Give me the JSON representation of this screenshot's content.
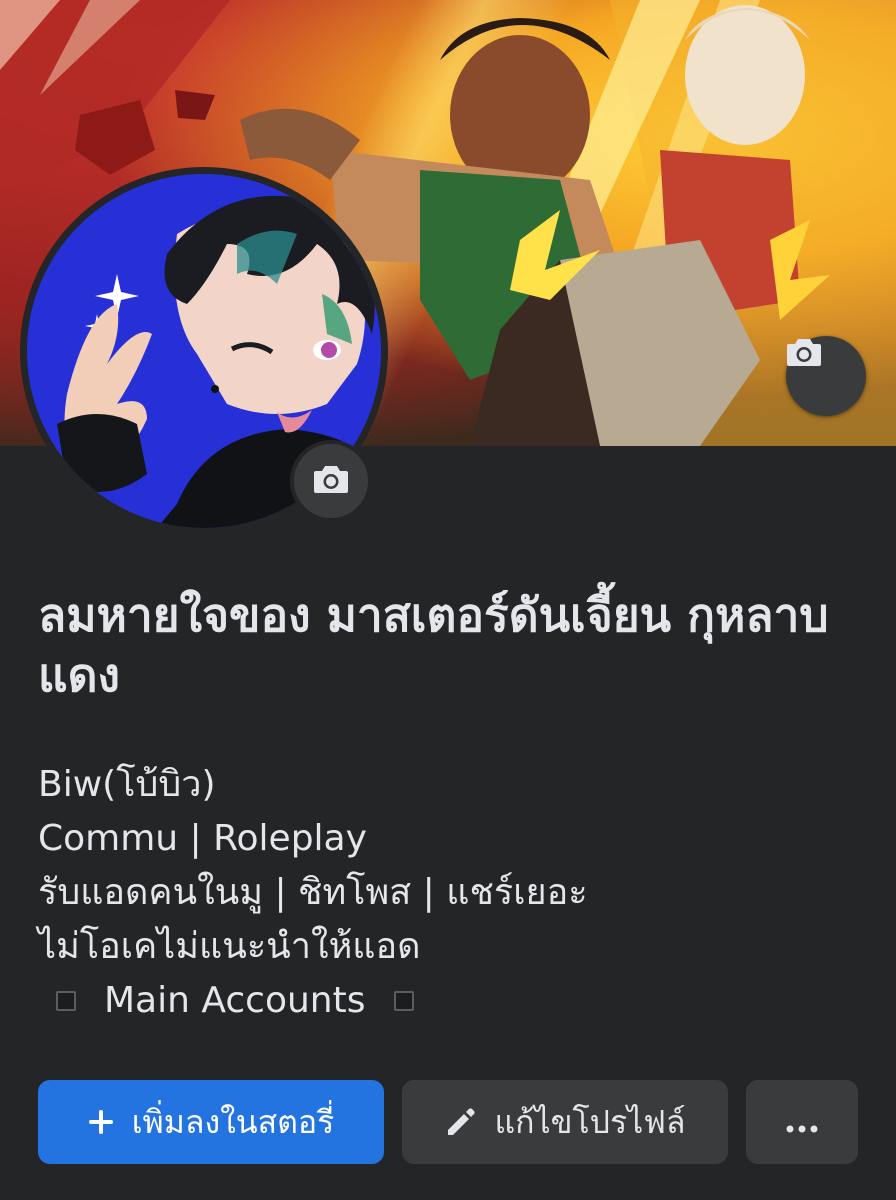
{
  "profile": {
    "name": "ลมหายใจของ มาสเตอร์ดันเจี้ยน กุหลาบแดง",
    "bio_lines": [
      "Biw(โบ้บิว)",
      "Commu | Roleplay",
      "รับแอดคนในมู | ชิทโพส | แชร์เยอะ",
      "ไม่โอเคไม่แนะนำให้แอด"
    ],
    "main_accounts": "Main Accounts"
  },
  "actions": {
    "add_story_label": "เพิ่มลงในสตอรี่",
    "edit_profile_label": "แก้ไขโปรไฟล์",
    "more_label": "···"
  },
  "icons": {
    "cover_camera": "camera-icon",
    "avatar_camera": "camera-icon",
    "add": "plus-icon",
    "edit": "pencil-icon",
    "more": "more-dots-icon"
  },
  "colors": {
    "background": "#242526",
    "primary_button": "#2374e1",
    "secondary_button": "#3a3b3c",
    "text": "#e4e6eb"
  }
}
